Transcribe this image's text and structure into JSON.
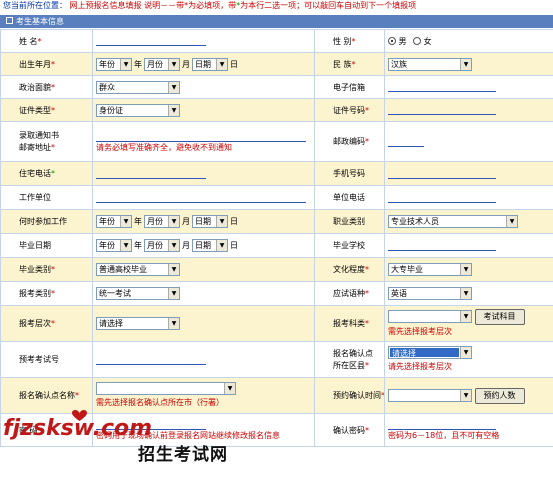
{
  "topbar": {
    "location_label": "您当前所在位置：",
    "location_value": "网上预报名信息填报",
    "note_prefix": "说明－－带",
    "note_req_mark": "*",
    "note_mid": "为必填项，带",
    "note_opt_mark": "*",
    "note_suffix": "为本行二选一项；可以敲回车自动到下一个填报项"
  },
  "section": {
    "title": "考生基本信息"
  },
  "fields": {
    "name": {
      "label": "姓  名",
      "mark": "*"
    },
    "gender": {
      "label": "性  别",
      "mark": "*",
      "male": "男",
      "female": "女"
    },
    "birth": {
      "label": "出生年月",
      "mark": "*",
      "year": "年份",
      "year_unit": "年",
      "month": "月份",
      "month_unit": "月",
      "day": "日期",
      "day_unit": "日"
    },
    "ethnicity": {
      "label": "民  族",
      "mark": "*",
      "value": "汉族"
    },
    "politics": {
      "label": "政治面貌",
      "mark": "*",
      "value": "群众"
    },
    "email": {
      "label": "电子信箱"
    },
    "id_type": {
      "label": "证件类型",
      "mark": "*",
      "value": "身份证"
    },
    "id_number": {
      "label": "证件号码",
      "mark": "*"
    },
    "mail_address": {
      "label_line1": "录取通知书",
      "label_line2": "邮寄地址",
      "mark": "*",
      "hint": "请务必填写准确齐全，避免收不到通知"
    },
    "postcode": {
      "label": "邮政编码",
      "mark": "*"
    },
    "home_phone": {
      "label": "住宅电话",
      "mark": "*"
    },
    "mobile": {
      "label": "手机号码"
    },
    "workplace": {
      "label": "工作单位"
    },
    "work_phone": {
      "label": "单位电话"
    },
    "work_start": {
      "label": "何时参加工作",
      "year": "年份",
      "year_unit": "年",
      "month": "月份",
      "month_unit": "月",
      "day": "日期",
      "day_unit": "日"
    },
    "job_type": {
      "label": "职业类别",
      "value": "专业技术人员"
    },
    "grad_date": {
      "label": "毕业日期",
      "year": "年份",
      "year_unit": "年",
      "month": "月份",
      "month_unit": "月",
      "day": "日期",
      "day_unit": "日"
    },
    "grad_school": {
      "label": "毕业学校"
    },
    "grad_type": {
      "label": "毕业类别",
      "mark": "*",
      "value": "普通高校毕业"
    },
    "education": {
      "label": "文化程度",
      "mark": "*",
      "value": "大专毕业"
    },
    "exam_type": {
      "label": "报考类别",
      "mark": "*",
      "value": "统一考试"
    },
    "language": {
      "label": "应试语种",
      "mark": "*",
      "value": "英语"
    },
    "level": {
      "label": "报考层次",
      "mark": "*",
      "value": "请选择"
    },
    "subject_cat": {
      "label": "报考科类",
      "mark": "*",
      "button": "考试科目",
      "hint": "需先选择报考层次"
    },
    "prev_exam_no": {
      "label": "预考考试号"
    },
    "confirm_area": {
      "label_line1": "报名确认点",
      "label_line2": "所在区县",
      "mark": "*",
      "value": "请选择",
      "hint": "请先选择报考层次"
    },
    "confirm_point": {
      "label": "报名确认点名称",
      "mark": "*",
      "hint": "需先选择报名确认点所在市（行署）"
    },
    "appoint_time": {
      "label": "预约确认时间",
      "mark": "*",
      "button": "预约人数"
    },
    "password": {
      "label": "密  码",
      "mark": "*",
      "hint": "密码用于现场确认前登录报名网站继续修改报名信息"
    },
    "confirm_password": {
      "label": "确认密码",
      "mark": "*",
      "hint": "密码为6－18位，且不可有空格"
    }
  },
  "watermark": {
    "latin": "fjzsksw.com",
    "chinese": "招生考试网"
  }
}
